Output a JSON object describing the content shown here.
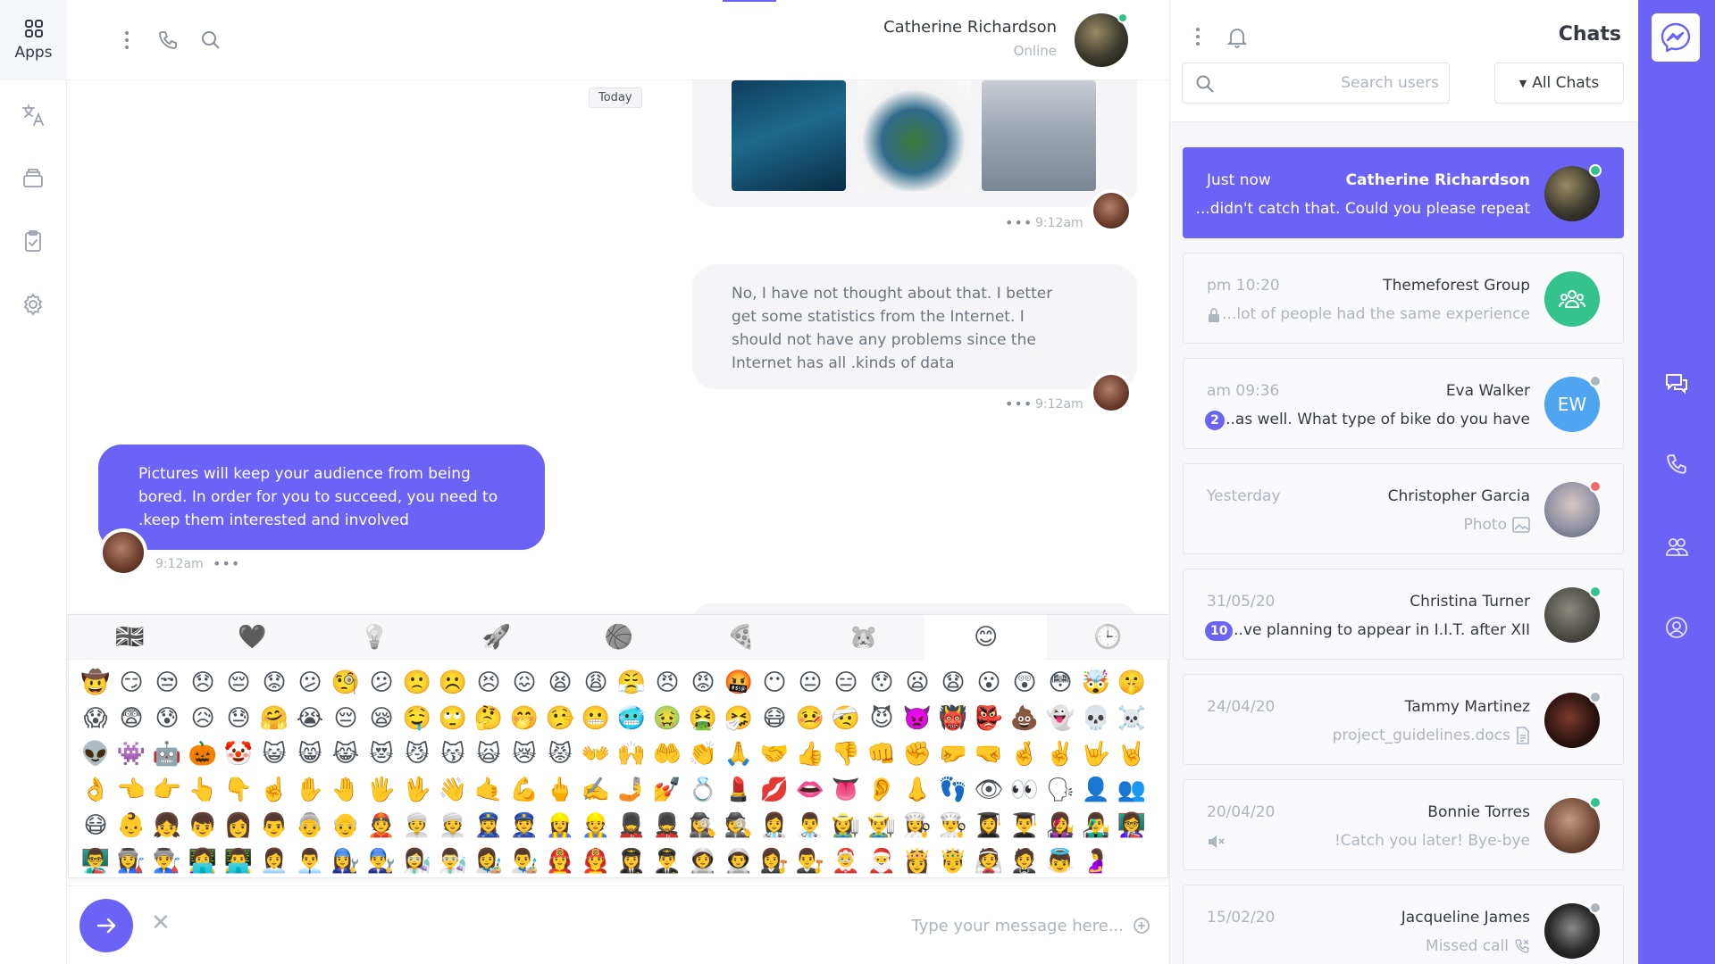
{
  "left_rail": {
    "apps_label": "Apps",
    "items": [
      "translate-icon",
      "inbox-icon",
      "clipboard-check-icon",
      "gear-icon"
    ]
  },
  "chat": {
    "contact_name": "Catherine Richardson",
    "contact_status": "Online",
    "date_divider": "Today",
    "messages": [
      {
        "type": "media",
        "time": "9:12am"
      },
      {
        "type": "incoming",
        "text": "No, I have not thought about that. I better get some statistics from the Internet. I should not have any problems since the Internet has all .kinds of data",
        "time": "9:12am"
      },
      {
        "type": "outgoing",
        "text": "Pictures will keep your audience from being bored. In order for you to succeed, you need to .keep them interested and involved",
        "time": "9:12am"
      }
    ],
    "emoji_tabs": [
      "🇬🇧",
      "🖤",
      "💡",
      "🚀",
      "🏀",
      "🍕",
      "🐹",
      "😊",
      "🕒"
    ],
    "emoji_active_tab": 7,
    "emojis": "🤠😏😒😞😔😟😕🧐😕🙁☹️😣😖😫😩😤😠😡🤬😶😐😑😯😦😧😮😲😳🤯🤫😱😨😰😥😓🤗😭😔😪🤤🙄🤔🤭🤥😬🥶🤢🤮🤧😷🤒🤕😈👿👹👺💩👻💀☠️👽👾🤖🎃🤡😺😸😹😻😼😽🙀😿😾👐🙌🤲👏🙏🤝👍👎👊✊🤛🤜🤞✌️🤟🤘👌👈👉👆👇☝️✋🤚🖐🖖👋🤙💪🖕✍️🤳💅💍💄💋👄👅👂👃👣👁👀🗣👤👥😷👶👧👦👩👨👵👴👲👳‍♀️👳👮‍♀️👮👷‍♀️👷💂‍♀️💂🕵️‍♀️🕵️👩‍⚕️👨‍⚕️👩‍🌾👨‍🌾👩‍🍳👨‍🍳👩‍🎓👨‍🎓👩‍🎤👨‍🎤👩‍🏫👨‍🏫👩‍🏭👨‍🏭👩‍💻👨‍💻👩‍💼👨‍💼👩‍🔧👨‍🔧👩‍🔬👨‍🔬👩‍🎨👨‍🎨👩‍🚒👨‍🚒👩‍✈️👨‍✈️👩‍🚀👨‍🚀👩‍⚖️👨‍⚖️🤶🎅👸🤴👰🤵👼🤰",
    "input_placeholder": "Type your message here..."
  },
  "panel": {
    "title": "Chats",
    "search_placeholder": "Search users",
    "filter_label": "All Chats",
    "chats": [
      {
        "time": "Just now",
        "name": "Catherine Richardson",
        "preview": "...didn't catch that. Could you please repeat"
      },
      {
        "time": "pm 10:20",
        "name": "Themeforest Group",
        "preview": "...lot of people had the same experience"
      },
      {
        "time": "am 09:36",
        "name": "Eva Walker",
        "preview": "...as well. What type of bike do you have",
        "badge": "2",
        "initials": "EW"
      },
      {
        "time": "Yesterday",
        "name": "Christopher Garcia",
        "preview": "Photo"
      },
      {
        "time": "31/05/20",
        "name": "Christina Turner",
        "preview": "...ve planning to appear in I.I.T. after XII",
        "badge": "10"
      },
      {
        "time": "24/04/20",
        "name": "Tammy Martinez",
        "preview": "project_guidelines.docs"
      },
      {
        "time": "20/04/20",
        "name": "Bonnie Torres",
        "preview": "!Catch you later! Bye-bye"
      },
      {
        "time": "15/02/20",
        "name": "Jacqueline James",
        "preview": "Missed call"
      }
    ]
  },
  "colors": {
    "accent": "#6b63f5",
    "online": "#34c38f",
    "busy": "#f46a6a",
    "away": "#adb5bd"
  }
}
